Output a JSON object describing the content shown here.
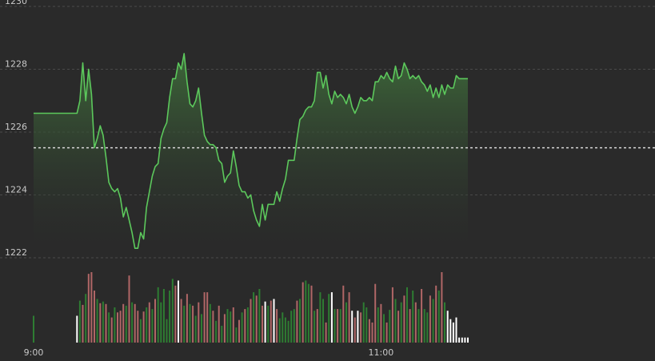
{
  "chart_data": {
    "type": "line",
    "title": "",
    "xlabel": "",
    "ylabel": "",
    "ylim": [
      1222,
      1230
    ],
    "y_ticks": [
      {
        "value": 1230,
        "label": "1230"
      },
      {
        "value": 1228,
        "label": "1228"
      },
      {
        "value": 1226,
        "label": "1226"
      },
      {
        "value": 1224,
        "label": "1224"
      },
      {
        "value": 1222,
        "label": "1222"
      }
    ],
    "x_range_minutes": [
      0,
      150
    ],
    "x_ticks": [
      {
        "minute": 0,
        "label": "9:00"
      },
      {
        "minute": 120,
        "label": "11:00"
      }
    ],
    "reference_value": 1225.5,
    "grid": true,
    "legend": "none",
    "colors": {
      "line": "#5cc85c",
      "area_top": "#3e6b3a",
      "up_volume": "#2e7d32",
      "down_volume": "#b06666",
      "neutral_volume": "#ffffff",
      "reference": "#d8d8d8"
    },
    "series": [
      {
        "x": [
          0,
          1,
          2,
          3,
          4,
          5,
          6,
          7,
          8,
          9,
          10,
          11,
          12,
          13,
          14,
          15,
          16,
          17,
          18,
          19,
          20,
          21,
          22,
          23,
          24,
          25,
          26,
          27,
          28,
          29,
          30,
          31,
          32,
          33,
          34,
          35,
          36,
          37,
          38,
          39,
          40,
          41,
          42,
          43,
          44,
          45,
          46,
          47,
          48,
          49,
          50,
          51,
          52,
          53,
          54,
          55,
          56,
          57,
          58,
          59,
          60,
          61,
          62,
          63,
          64,
          65,
          66,
          67,
          68,
          69,
          70,
          71,
          72,
          73,
          74,
          75,
          76,
          77,
          78,
          79,
          80,
          81,
          82,
          83,
          84,
          85,
          86,
          87,
          88,
          89,
          90,
          91,
          92,
          93,
          94,
          95,
          96,
          97,
          98,
          99,
          100,
          101,
          102,
          103,
          104,
          105,
          106,
          107,
          108,
          109,
          110,
          111,
          112,
          113,
          114,
          115,
          116,
          117,
          118,
          119,
          120,
          121,
          122,
          123,
          124,
          125,
          126,
          127,
          128,
          129,
          130,
          131,
          132,
          133,
          134,
          135,
          136,
          137,
          138,
          139,
          140,
          141,
          142,
          143,
          144,
          145,
          146,
          147,
          148,
          149,
          150
        ],
        "y": [
          1226.6,
          1226.6,
          1226.6,
          1226.6,
          1226.6,
          1226.6,
          1226.6,
          1226.6,
          1226.6,
          1226.6,
          1226.6,
          1226.6,
          1226.6,
          1226.6,
          1226.6,
          1226.6,
          1227.0,
          1228.2,
          1227.0,
          1228.0,
          1227.2,
          1225.5,
          1225.8,
          1226.2,
          1225.9,
          1225.2,
          1224.4,
          1224.2,
          1224.1,
          1224.2,
          1223.9,
          1223.3,
          1223.6,
          1223.2,
          1222.8,
          1222.3,
          1222.3,
          1222.8,
          1222.6,
          1223.6,
          1224.1,
          1224.6,
          1224.9,
          1225.0,
          1225.8,
          1226.1,
          1226.3,
          1227.1,
          1227.7,
          1227.7,
          1228.2,
          1228.0,
          1228.5,
          1227.6,
          1226.9,
          1226.8,
          1227.0,
          1227.4,
          1226.6,
          1225.9,
          1225.7,
          1225.6,
          1225.6,
          1225.5,
          1225.1,
          1225.0,
          1224.4,
          1224.6,
          1224.7,
          1225.4,
          1224.9,
          1224.3,
          1224.1,
          1224.1,
          1223.9,
          1224.0,
          1223.5,
          1223.2,
          1223.0,
          1223.7,
          1223.2,
          1223.7,
          1223.7,
          1223.7,
          1224.1,
          1223.8,
          1224.2,
          1224.5,
          1225.1,
          1225.1,
          1225.1,
          1225.8,
          1226.4,
          1226.5,
          1226.7,
          1226.8,
          1226.8,
          1227.0,
          1227.9,
          1227.9,
          1227.4,
          1227.8,
          1227.2,
          1226.9,
          1227.3,
          1227.1,
          1227.2,
          1227.1,
          1226.9,
          1227.2,
          1226.8,
          1226.6,
          1226.8,
          1227.1,
          1227.0,
          1227.0,
          1227.1,
          1227.0,
          1227.6,
          1227.6,
          1227.8,
          1227.7,
          1227.9,
          1227.7,
          1227.6,
          1228.1,
          1227.7,
          1227.8,
          1228.2,
          1228.0,
          1227.7,
          1227.8,
          1227.7,
          1227.8,
          1227.6,
          1227.5,
          1227.3,
          1227.5,
          1227.1,
          1227.4,
          1227.1,
          1227.5,
          1227.2,
          1227.5,
          1227.4,
          1227.4,
          1227.8,
          1227.7,
          1227.7,
          1227.7,
          1227.7
        ]
      }
    ],
    "volume": {
      "x": [
        0,
        15,
        16,
        17,
        18,
        19,
        20,
        21,
        22,
        23,
        24,
        25,
        26,
        27,
        28,
        29,
        30,
        31,
        32,
        33,
        34,
        35,
        36,
        37,
        38,
        39,
        40,
        41,
        42,
        43,
        44,
        45,
        46,
        47,
        48,
        49,
        50,
        51,
        52,
        53,
        54,
        55,
        56,
        57,
        58,
        59,
        60,
        61,
        62,
        63,
        64,
        65,
        66,
        67,
        68,
        69,
        70,
        71,
        72,
        73,
        74,
        75,
        76,
        77,
        78,
        79,
        80,
        81,
        82,
        83,
        84,
        85,
        86,
        87,
        88,
        89,
        90,
        91,
        92,
        93,
        94,
        95,
        96,
        97,
        98,
        99,
        100,
        101,
        102,
        103,
        104,
        105,
        106,
        107,
        108,
        109,
        110,
        111,
        112,
        113,
        114,
        115,
        116,
        117,
        118,
        119,
        120,
        121,
        122,
        123,
        124,
        125,
        126,
        127,
        128,
        129,
        130,
        131,
        132,
        133,
        134,
        135,
        136,
        137,
        138,
        139,
        140,
        141,
        142,
        143,
        144,
        145,
        146,
        147,
        148,
        149,
        150
      ],
      "v": [
        32,
        32,
        50,
        45,
        58,
        82,
        84,
        62,
        52,
        47,
        49,
        46,
        36,
        30,
        42,
        36,
        38,
        46,
        44,
        80,
        48,
        46,
        38,
        28,
        37,
        42,
        48,
        40,
        52,
        66,
        48,
        64,
        28,
        62,
        76,
        68,
        74,
        52,
        44,
        58,
        46,
        44,
        32,
        48,
        34,
        60,
        60,
        46,
        38,
        26,
        44,
        20,
        34,
        40,
        37,
        42,
        18,
        27,
        36,
        40,
        42,
        52,
        60,
        56,
        64,
        44,
        49,
        44,
        50,
        52,
        40,
        29,
        36,
        30,
        26,
        38,
        40,
        50,
        52,
        72,
        74,
        70,
        68,
        38,
        40,
        60,
        52,
        24,
        58,
        60,
        40,
        40,
        40,
        68,
        48,
        60,
        38,
        30,
        38,
        36,
        48,
        42,
        28,
        24,
        70,
        42,
        46,
        34,
        24,
        39,
        66,
        52,
        38,
        48,
        56,
        66,
        40,
        62,
        48,
        40,
        64,
        40,
        36,
        56,
        52,
        68,
        62,
        84,
        48,
        38,
        28,
        24,
        30,
        6,
        6,
        6,
        6
      ],
      "dir": [
        "u",
        "n",
        "u",
        "d",
        "u",
        "d",
        "d",
        "d",
        "u",
        "d",
        "u",
        "d",
        "u",
        "d",
        "u",
        "d",
        "d",
        "d",
        "u",
        "d",
        "u",
        "d",
        "d",
        "u",
        "d",
        "u",
        "d",
        "u",
        "d",
        "u",
        "u",
        "u",
        "u",
        "u",
        "u",
        "d",
        "n",
        "d",
        "u",
        "d",
        "u",
        "d",
        "u",
        "d",
        "u",
        "d",
        "d",
        "u",
        "d",
        "u",
        "d",
        "u",
        "d",
        "u",
        "u",
        "d",
        "u",
        "d",
        "u",
        "d",
        "u",
        "d",
        "u",
        "d",
        "u",
        "d",
        "n",
        "u",
        "d",
        "n",
        "d",
        "u",
        "u",
        "u",
        "u",
        "u",
        "u",
        "d",
        "u",
        "d",
        "u",
        "u",
        "d",
        "u",
        "d",
        "u",
        "u",
        "d",
        "u",
        "n",
        "u",
        "d",
        "u",
        "d",
        "u",
        "d",
        "n",
        "d",
        "n",
        "d",
        "u",
        "u",
        "d",
        "d",
        "d",
        "u",
        "d",
        "u",
        "d",
        "u",
        "d",
        "u",
        "d",
        "u",
        "d",
        "u",
        "d",
        "u",
        "d",
        "u",
        "d",
        "u",
        "u",
        "d",
        "u",
        "d",
        "u",
        "d",
        "u",
        "n",
        "n",
        "n",
        "n",
        "n",
        "n",
        "n",
        "n"
      ]
    }
  }
}
